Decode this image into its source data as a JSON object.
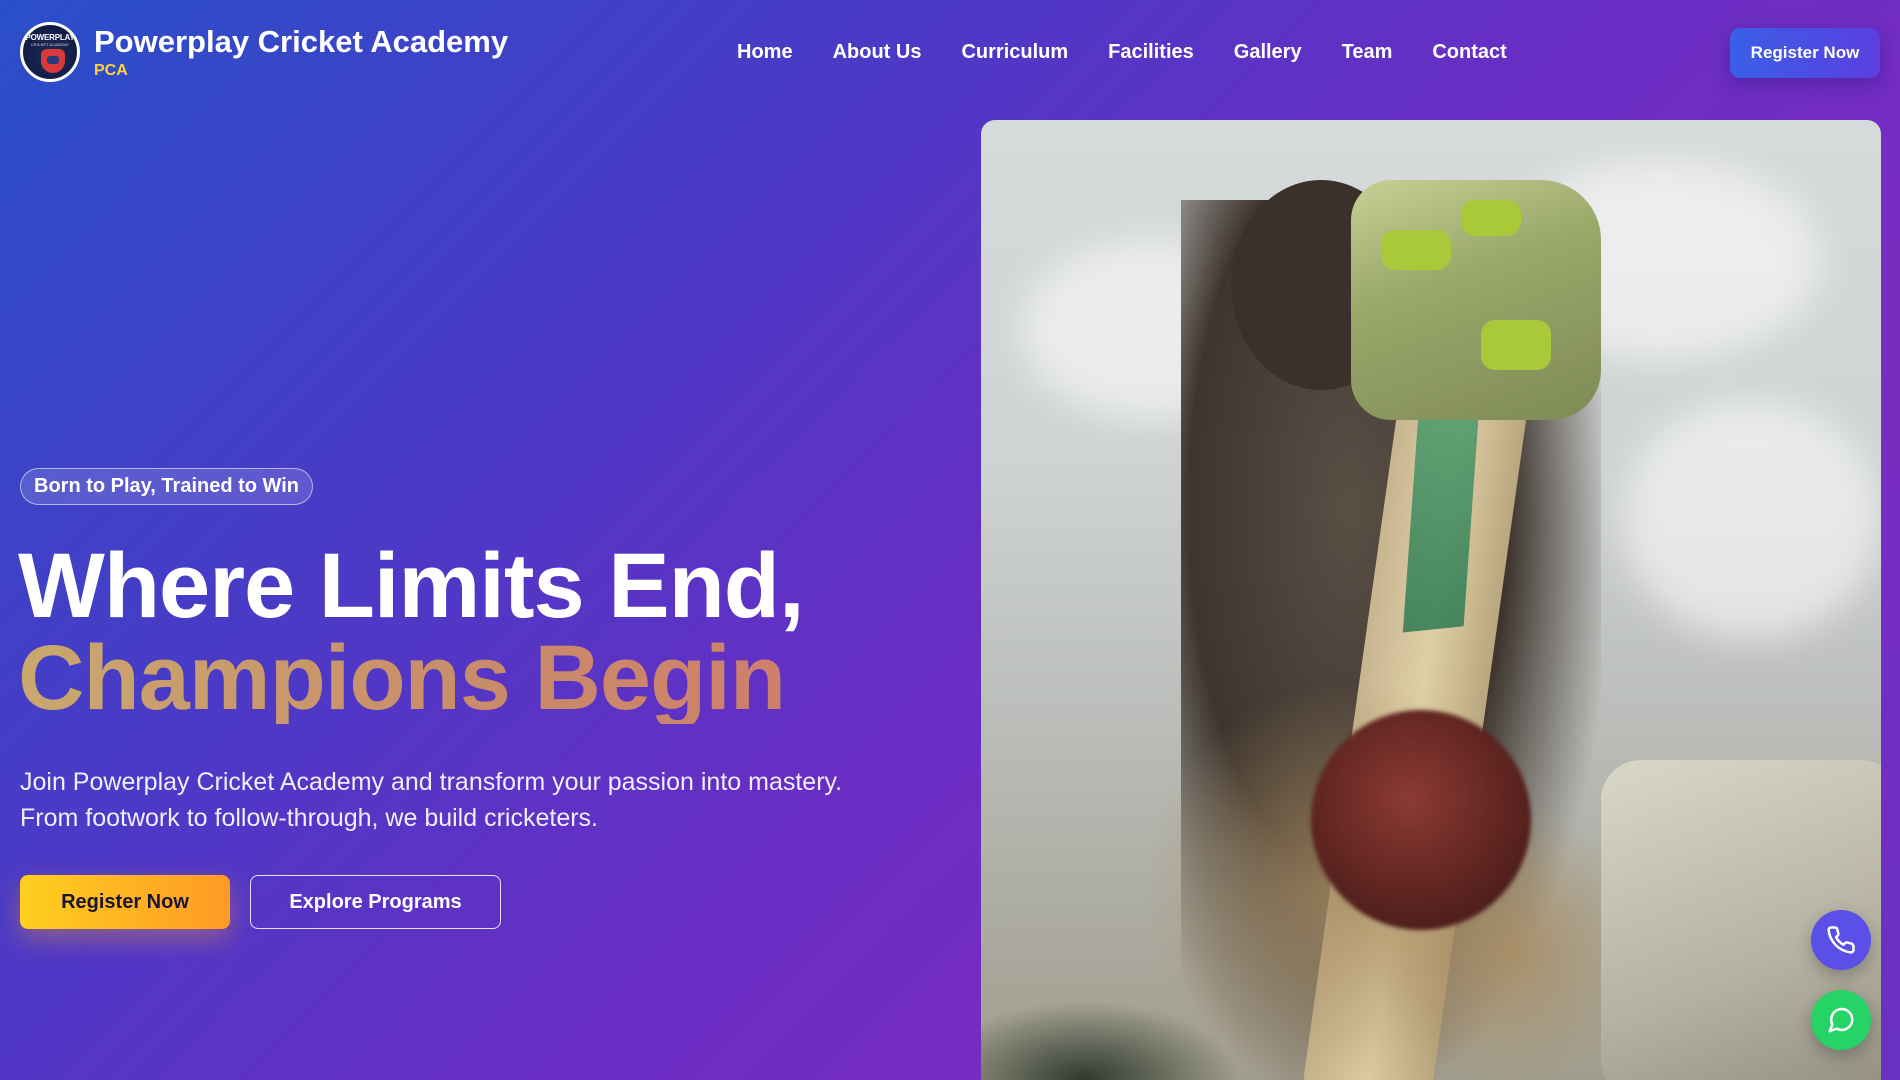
{
  "header": {
    "brand_name": "Powerplay Cricket Academy",
    "brand_abbr": "PCA",
    "logo_text": "POWERPLAY",
    "logo_subtext": "CRICKET ACADEMY",
    "nav": [
      "Home",
      "About Us",
      "Curriculum",
      "Facilities",
      "Gallery",
      "Team",
      "Contact"
    ],
    "cta_label": "Register Now"
  },
  "hero": {
    "badge": "Born to Play, Trained to Win",
    "headline_line1": "Where Limits End,",
    "headline_line2": "Champions Begin",
    "subtext_line1": "Join Powerplay Cricket Academy and transform your passion into mastery.",
    "subtext_line2": "From footwork to follow-through, we build cricketers.",
    "primary_button": "Register Now",
    "secondary_button": "Explore Programs"
  },
  "floating_actions": {
    "phone_icon": "phone-icon",
    "chat_icon": "chat-icon"
  },
  "colors": {
    "accent_yellow": "#ffd23a",
    "cta_blue": "#3a5fe6",
    "whatsapp_green": "#25d366"
  }
}
